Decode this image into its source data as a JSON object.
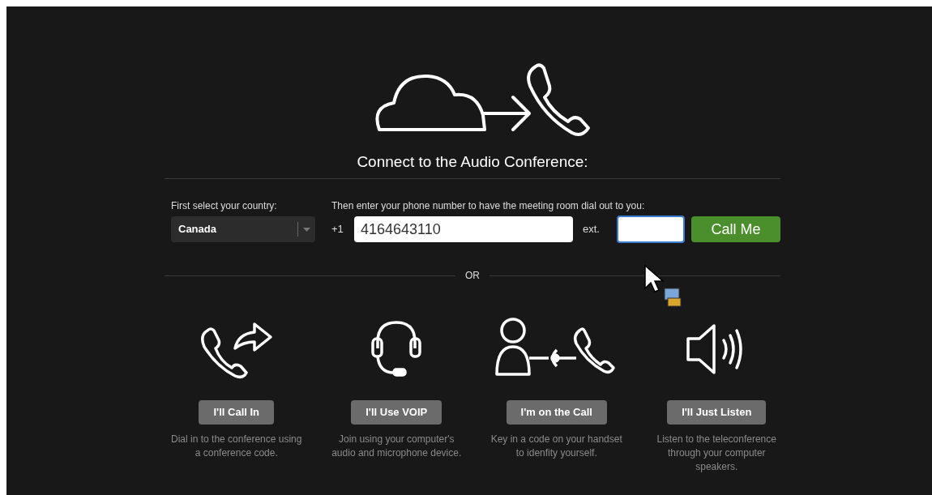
{
  "title": "Connect to the Audio Conference:",
  "dial_out": {
    "country_label": "First select your country:",
    "country": "Canada",
    "phone_label": "Then enter your phone number to have the meeting room dial out to you:",
    "prefix": "+1",
    "phone": "4164643110",
    "ext_label": "ext.",
    "button": "Call Me"
  },
  "separator": "OR",
  "options": [
    {
      "kind": "call-in",
      "button": "I'll Call In",
      "description": "Dial in to the conference using a conference code."
    },
    {
      "kind": "voip",
      "button": "I'll Use VOIP",
      "description": "Join using your computer's audio and microphone device."
    },
    {
      "kind": "on-call",
      "button": "I'm on the Call",
      "description": "Key in a code on your handset to idenfity yourself."
    },
    {
      "kind": "listen",
      "button": "I'll Just Listen",
      "description": "Listen to the teleconference through your computer speakers."
    }
  ]
}
